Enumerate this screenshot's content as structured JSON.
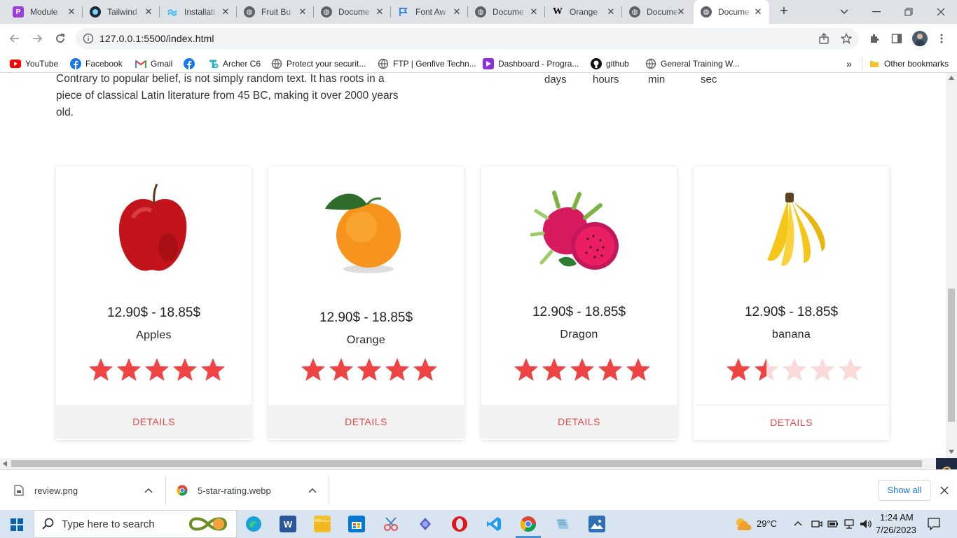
{
  "browser": {
    "tabs": [
      {
        "label": "Module",
        "icon": "module-icon",
        "color": "#9b3fd6"
      },
      {
        "label": "Tailwind",
        "icon": "tailwind-icon",
        "color": "#38bdf8"
      },
      {
        "label": "Installati",
        "icon": "tailwind-icon",
        "color": "#38bdf8"
      },
      {
        "label": "Fruit Bu",
        "icon": "globe-icon",
        "color": "#5f6368"
      },
      {
        "label": "Docume",
        "icon": "globe-icon",
        "color": "#5f6368"
      },
      {
        "label": "Font Aw",
        "icon": "flag-icon",
        "color": "#1a73e8"
      },
      {
        "label": "Docume",
        "icon": "globe-icon",
        "color": "#5f6368"
      },
      {
        "label": "Orange",
        "icon": "wikipedia-icon",
        "color": "#000000"
      },
      {
        "label": "Docume",
        "icon": "globe-icon",
        "color": "#5f6368"
      },
      {
        "label": "Docume",
        "icon": "globe-icon",
        "color": "#5f6368",
        "active": true
      }
    ],
    "url": "127.0.0.1:5500/index.html",
    "bookmarks": [
      {
        "label": "YouTube",
        "icon": "youtube-icon"
      },
      {
        "label": "Facebook",
        "icon": "facebook-icon"
      },
      {
        "label": "Gmail",
        "icon": "gmail-icon"
      },
      {
        "label": "",
        "icon": "facebook-icon"
      },
      {
        "label": "Archer C6",
        "icon": "tplink-icon"
      },
      {
        "label": "Protect your securit...",
        "icon": "globe-icon"
      },
      {
        "label": "FTP | Genfive Techn...",
        "icon": "globe-icon"
      },
      {
        "label": "Dashboard - Progra...",
        "icon": "programming-hero-icon"
      },
      {
        "label": "github",
        "icon": "github-icon"
      },
      {
        "label": "General Training W...",
        "icon": "globe-icon"
      }
    ],
    "other_bookmarks": "Other bookmarks"
  },
  "page": {
    "intro": "Contrary to popular belief, is not simply random text. It has roots in a piece of classical Latin literature from 45 BC, making it over 2000 years old.",
    "countdown_labels": [
      "days",
      "hours",
      "min",
      "sec"
    ],
    "cards": [
      {
        "price": "12.90$ - 18.85$",
        "name": "Apples",
        "rating": 5,
        "details": "DETAILS",
        "image": "apple-image"
      },
      {
        "price": "12.90$ - 18.85$",
        "name": "Orange",
        "rating": 5,
        "details": "DETAILS",
        "image": "orange-image"
      },
      {
        "price": "12.90$ - 18.85$",
        "name": "Dragon",
        "rating": 5,
        "details": "DETAILS",
        "image": "dragon-fruit-image"
      },
      {
        "price": "12.90$ - 18.85$",
        "name": "banana",
        "rating": 1.5,
        "details": "DETAILS",
        "image": "banana-image"
      }
    ],
    "star_color": "#ef4444",
    "star_empty_color": "#fcd9d9",
    "details_color": "#e04c4c"
  },
  "downloads": {
    "items": [
      {
        "name": "review.png",
        "icon": "file-icon"
      },
      {
        "name": "5-star-rating.webp",
        "icon": "chrome-icon"
      }
    ],
    "show_all": "Show all"
  },
  "taskbar": {
    "search_placeholder": "Type here to search",
    "weather": "29°C",
    "time": "1:24 AM",
    "date": "7/26/2023"
  }
}
